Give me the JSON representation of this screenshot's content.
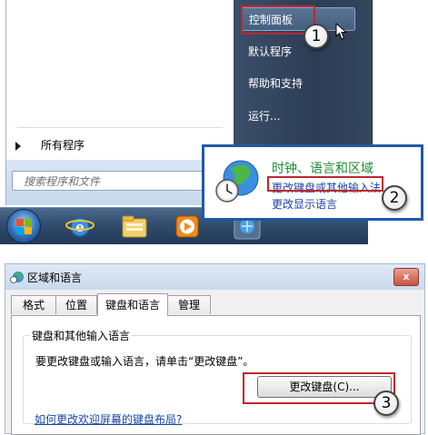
{
  "start_menu": {
    "all_programs": "所有程序",
    "search_placeholder": "搜索程序和文件",
    "right_items": [
      "控制面板",
      "默认程序",
      "帮助和支持",
      "运行..."
    ]
  },
  "category_popup": {
    "title": "时钟、语言和区域",
    "link_keyboard": "更改键盘或其他输入法",
    "link_display_language": "更改显示语言"
  },
  "callouts": [
    "1",
    "2",
    "3"
  ],
  "dialog": {
    "title": "区域和语言",
    "close_glyph": "x",
    "tabs": [
      "格式",
      "位置",
      "键盘和语言",
      "管理"
    ],
    "active_tab": "键盘和语言",
    "group_label": "键盘和其他输入语言",
    "group_desc": "要更改键盘或输入语言，请单击“更改键盘”。",
    "change_keyboard_button": "更改键盘(C)...",
    "help_link": "如何更改欢迎屏幕的键盘布局?"
  },
  "colors": {
    "highlight_red": "#c0272d",
    "link_blue": "#1a46a8",
    "category_green": "#1e8a31",
    "popup_border": "#1e5aa8",
    "start_right_pane": "#2c3d55"
  },
  "icons": [
    "start-orb-icon",
    "internet-explorer-icon",
    "explorer-folder-icon",
    "media-player-icon",
    "network-icon",
    "globe-clock-icon",
    "mouse-cursor-icon",
    "region-language-icon",
    "close-icon"
  ]
}
